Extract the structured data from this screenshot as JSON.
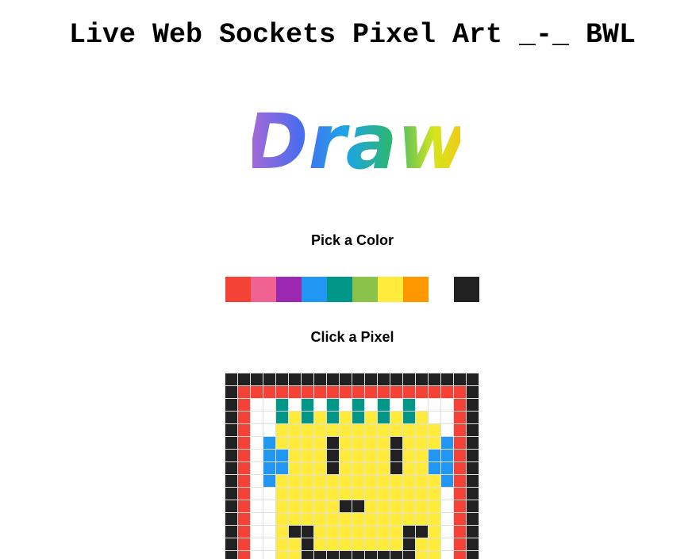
{
  "header": {
    "title": "Live Web Sockets Pixel Art _-_ BWL"
  },
  "logo": {
    "text": "Draw",
    "gradient": [
      "#b06ad3",
      "#4a6cf0",
      "#1ca4e8",
      "#2bb673",
      "#d6e51b",
      "#f5c518"
    ]
  },
  "labels": {
    "pick": "Pick a Color",
    "click": "Click a Pixel"
  },
  "palette": [
    {
      "name": "red",
      "hex": "#f44336"
    },
    {
      "name": "pink",
      "hex": "#f06292"
    },
    {
      "name": "purple",
      "hex": "#9c27b0"
    },
    {
      "name": "blue",
      "hex": "#2196f3"
    },
    {
      "name": "teal",
      "hex": "#009688"
    },
    {
      "name": "green",
      "hex": "#8bc34a"
    },
    {
      "name": "yellow",
      "hex": "#ffeb3b"
    },
    {
      "name": "orange",
      "hex": "#ff9800"
    },
    {
      "name": "white",
      "hex": "#ffffff"
    },
    {
      "name": "black",
      "hex": "#212121"
    }
  ],
  "canvas": {
    "legend": {
      "K": "#212121",
      "R": "#f44336",
      "W": "#ffffff",
      "T": "#009688",
      "Y": "#ffeb3b",
      "B": "#2196f3"
    },
    "rows": [
      "KKKKKKKKKKKKKKKKKKKK",
      "KRRRRRRRRRRRRRRRRRRK",
      "KRWWTWTWTWTWTWTWWWRK",
      "KRWWTYTYTYTYTYTYWWRK",
      "KRWWYYYYYYYYYYYYYWRK",
      "KRWBYYYYKYYYYKYYYBRK",
      "KRWBBYYYKYYYYKYYBBRK",
      "KRWBBYYYKYYYYKYYBBRK",
      "KRWBYYYYYYYYYYYYYBRK",
      "KRWWYYYYYYYYYYYYYWRK",
      "KRWWYYYYYKKYYYYYYWRK",
      "KRWWYYYYYYYYYYYYYWRK",
      "KRWWYKKYYYYYYYKKYWRK",
      "KRWWYYKYYYYYYYKYYWRK",
      "KRWWYYKKKKKKKKKYYWRK"
    ]
  }
}
